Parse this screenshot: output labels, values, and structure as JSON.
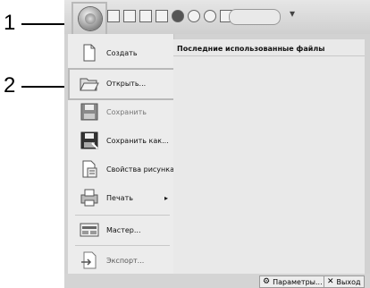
{
  "callouts": {
    "one": "1",
    "two": "2"
  },
  "menu": {
    "items": [
      {
        "label": "Создать",
        "icon": "new-document-icon",
        "submenu": false
      },
      {
        "label": "Открыть...",
        "icon": "open-folder-icon",
        "submenu": false
      },
      {
        "label": "Сохранить",
        "icon": "save-icon",
        "submenu": false
      },
      {
        "label": "Сохранить как...",
        "icon": "save-as-icon",
        "submenu": false
      },
      {
        "label": "Свойства рисунка",
        "icon": "design-properties-icon",
        "submenu": false
      },
      {
        "label": "Печать",
        "icon": "print-icon",
        "submenu": true
      },
      {
        "label": "Мастер...",
        "icon": "wizard-icon",
        "submenu": false
      },
      {
        "label": "Экспорт...",
        "icon": "export-icon",
        "submenu": false
      }
    ],
    "submenu_arrow": "▸"
  },
  "recent": {
    "title": "Последние использованные файлы"
  },
  "footer": {
    "options": "Параметры...",
    "exit": "Выход"
  },
  "qat": {
    "dropdown": "▾"
  },
  "colors": {
    "menu_bg": "#ececec",
    "highlight": "#b9b9b9"
  }
}
